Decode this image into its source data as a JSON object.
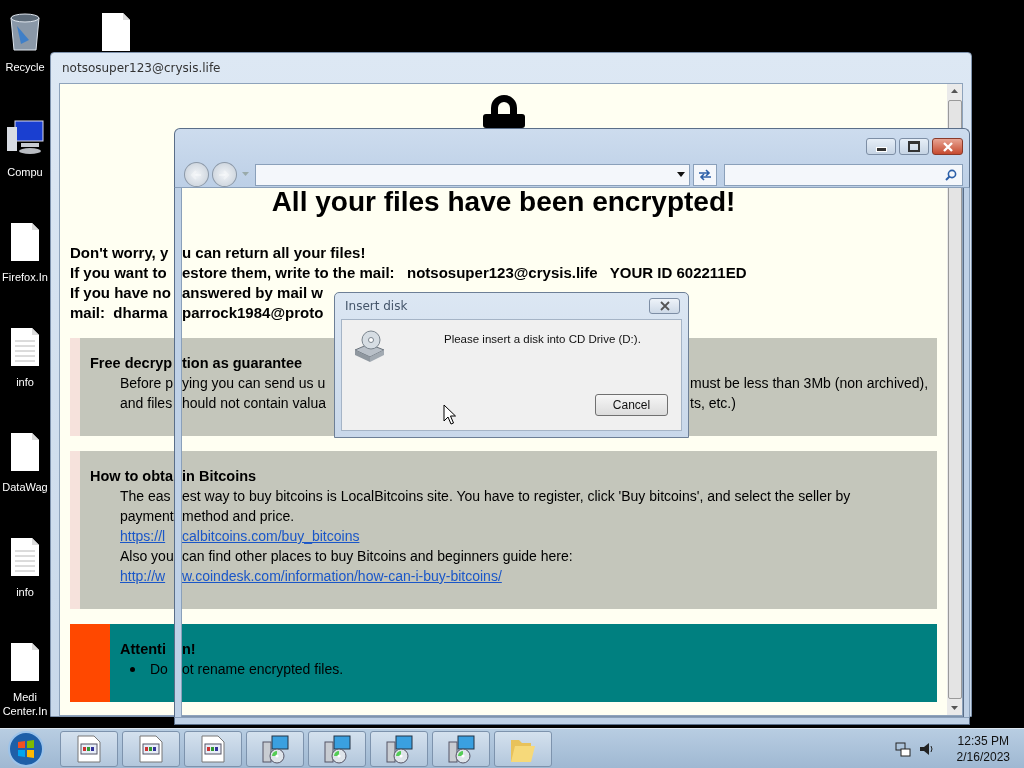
{
  "desktop_file_icon": {
    "kind": "document"
  },
  "desktop_icons": [
    {
      "kind": "recycle",
      "label": "Recycle"
    },
    {
      "kind": "computer",
      "label": "Compu"
    },
    {
      "kind": "document",
      "label": "Firefox.In"
    },
    {
      "kind": "text",
      "label": "info"
    },
    {
      "kind": "document",
      "label": "DataWag"
    },
    {
      "kind": "text",
      "label": "info"
    },
    {
      "kind": "document",
      "label": "Medi Center.In"
    }
  ],
  "note_window": {
    "title": "notsosuper123@crysis.life",
    "heading": "All your files have been encrypted!",
    "lines": [
      {
        "parts": [
          "Don't worry, y",
          "u can return all your files!"
        ]
      },
      {
        "parts": [
          "If you want to",
          "estore them, write to the mail:   notsosuper123@crysis.life   YOUR ID 602211ED"
        ]
      },
      {
        "parts": [
          "If you have no",
          "answered by mail w"
        ]
      },
      {
        "parts": [
          "mail:  dharma",
          "parrock1984@proto"
        ]
      }
    ],
    "sections": [
      {
        "kind": "info",
        "title": [
          "Free decryp",
          "tion as guarantee"
        ],
        "rows": [
          {
            "kind": "text",
            "parts": [
              "Before p",
              "ying you can send us u"
            ],
            "right": "must be less than 3Mb (non archived),"
          },
          {
            "kind": "text",
            "parts": [
              "and files",
              "hould not contain valua"
            ],
            "right": "ts, etc.)"
          }
        ]
      },
      {
        "kind": "info",
        "title": [
          "How to obta",
          "in Bitcoins"
        ],
        "rows": [
          {
            "kind": "text",
            "parts": [
              "The eas",
              "est way to buy bitcoins is LocalBitcoins site. You have to register, click 'Buy bitcoins', and select the seller by"
            ]
          },
          {
            "kind": "text",
            "parts": [
              "payment",
              "method and price."
            ]
          },
          {
            "kind": "link",
            "parts": [
              "https://l",
              "calbitcoins.com/buy_bitcoins"
            ]
          },
          {
            "kind": "text",
            "parts": [
              "Also you",
              "can find other places to buy Bitcoins and beginners guide here:"
            ]
          },
          {
            "kind": "link",
            "parts": [
              "http://w",
              "w.coindesk.com/information/how-can-i-buy-bitcoins/"
            ]
          }
        ]
      },
      {
        "kind": "attention",
        "title": [
          "Attenti",
          "n!"
        ],
        "rows": [
          {
            "kind": "bullet",
            "parts": [
              "Do",
              "ot rename encrypted files."
            ]
          }
        ]
      }
    ]
  },
  "explorer_window": {
    "back_disabled": true,
    "forward_disabled": true
  },
  "dialog": {
    "title": "Insert disk",
    "message": "Please insert a disk into CD Drive (D:).",
    "button": "Cancel"
  },
  "taskbar": {
    "buttons": [
      {
        "kind": "document"
      },
      {
        "kind": "document"
      },
      {
        "kind": "document"
      },
      {
        "kind": "installer"
      },
      {
        "kind": "installer"
      },
      {
        "kind": "installer"
      },
      {
        "kind": "installer"
      },
      {
        "kind": "folder"
      }
    ],
    "time": "12:35 PM",
    "date": "2/16/2023"
  }
}
